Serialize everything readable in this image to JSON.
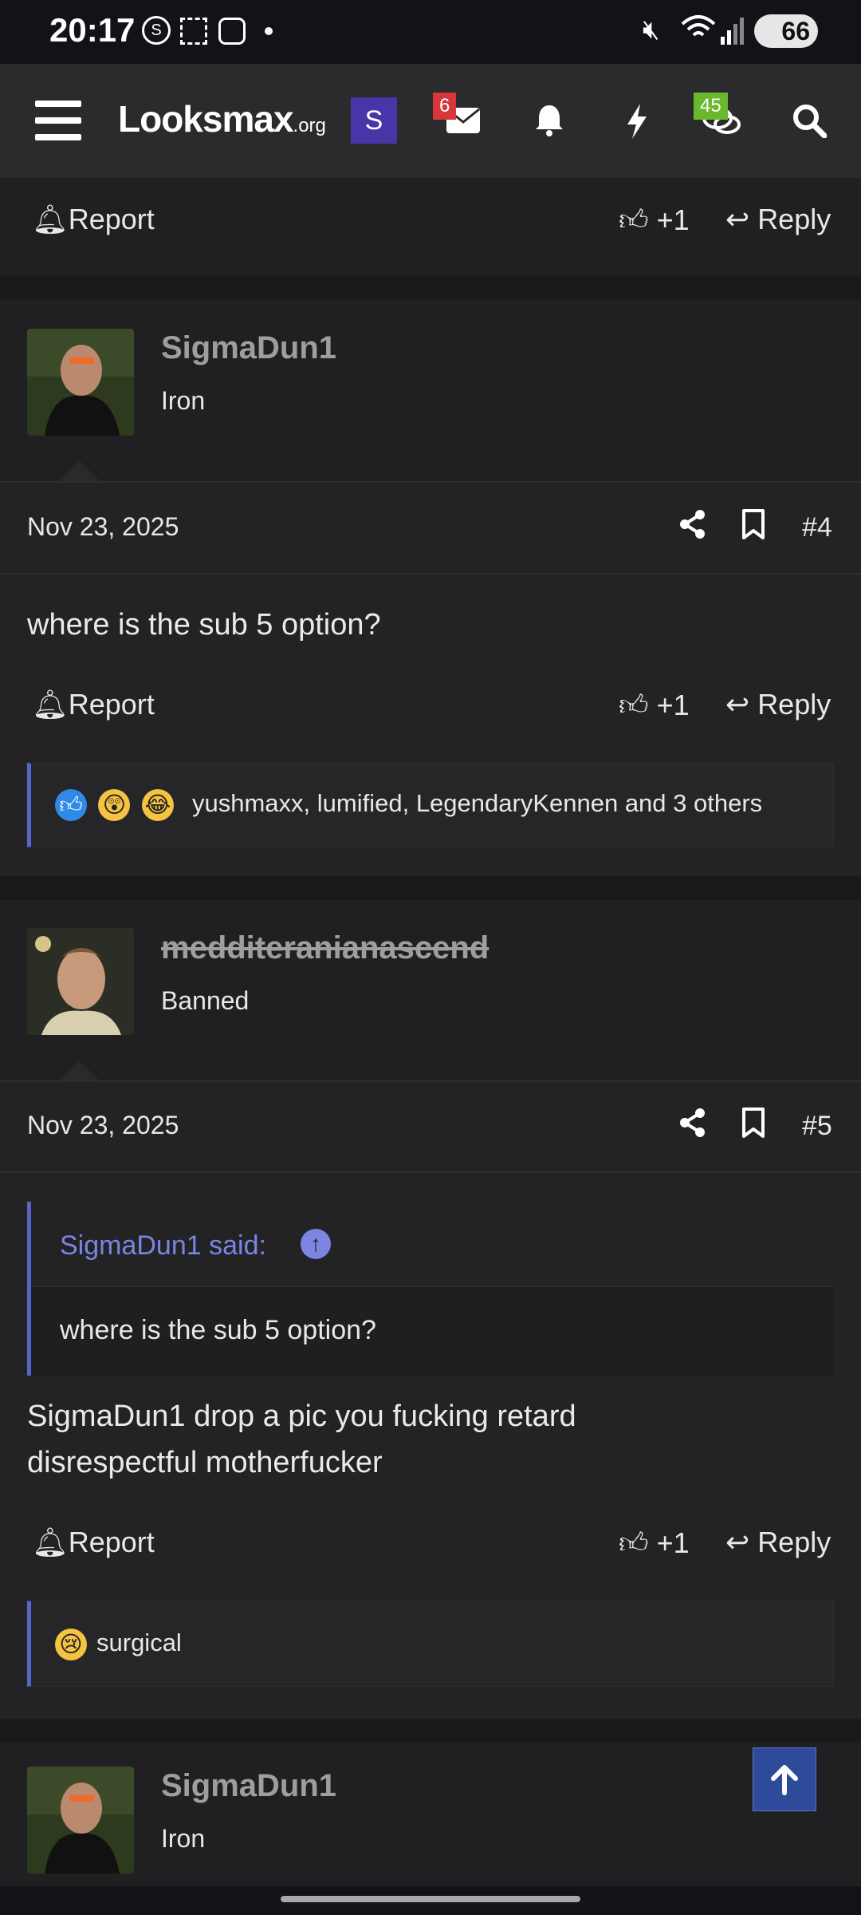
{
  "status_bar": {
    "time": "20:17",
    "battery": "66"
  },
  "nav": {
    "logo_text": "Looksmax",
    "logo_suffix": ".org",
    "avatar_letter": "S",
    "inbox_badge": "6",
    "chat_badge": "45"
  },
  "actions": {
    "report": "Report",
    "like": "+1",
    "reply": "Reply"
  },
  "posts": [
    {
      "username": "SigmaDun1",
      "user_title": "Iron",
      "date": "Nov 23, 2025",
      "post_number": "#4",
      "body": "where is the sub 5 option?",
      "reactions": "yushmaxx, lumified, LegendaryKennen and 3 others"
    },
    {
      "username": "medditeranianascend",
      "user_title": "Banned",
      "date": "Nov 23, 2025",
      "post_number": "#5",
      "quote_author": "SigmaDun1 said:",
      "quote_text": "where is the sub 5 option?",
      "body_line1": "SigmaDun1 drop a pic you fucking retard",
      "body_line2": "disrespectful motherfucker",
      "reactions": "surgical"
    },
    {
      "username": "SigmaDun1",
      "user_title": "Iron"
    }
  ],
  "colors": {
    "accent": "#5865c6",
    "banned": "#9e9e9e",
    "inbox_badge": "#d8363a",
    "chat_badge": "#6ab82c"
  }
}
